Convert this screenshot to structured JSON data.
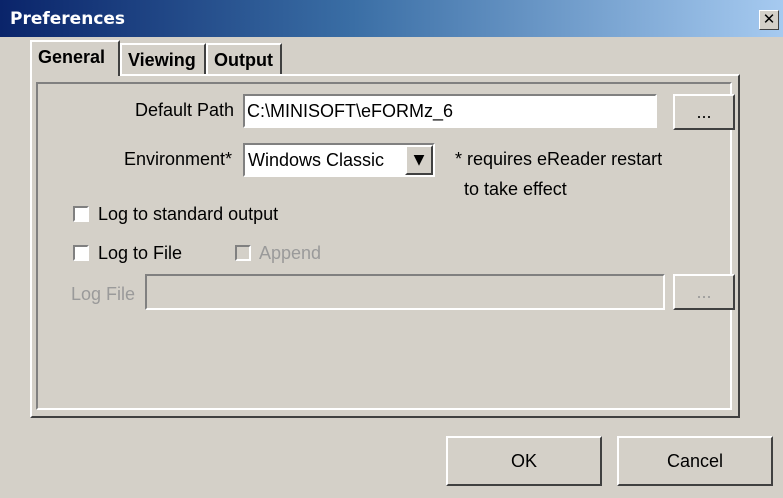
{
  "window": {
    "title": "Preferences",
    "close_glyph": "✕"
  },
  "tabs": [
    {
      "label": "General",
      "active": true
    },
    {
      "label": "Viewing",
      "active": false
    },
    {
      "label": "Output",
      "active": false
    }
  ],
  "general": {
    "default_path_label": "Default Path",
    "default_path_value": "C:\\MINISOFT\\eFORMz_6",
    "browse_label": "...",
    "environment_label": "Environment*",
    "environment_value": "Windows Classic",
    "environment_note_line1": "* requires eReader restart",
    "environment_note_line2": "to take effect",
    "log_stdout_label": "Log to standard output",
    "log_stdout_checked": false,
    "log_file_label": "Log to File",
    "log_file_checked": false,
    "append_label": "Append",
    "append_checked": false,
    "append_enabled": false,
    "log_file_field_label": "Log File",
    "log_file_value": "",
    "log_browse_label": "..."
  },
  "footer": {
    "ok_label": "OK",
    "cancel_label": "Cancel"
  },
  "icons": {
    "dropdown": "chevron-down-icon",
    "close": "close-icon"
  }
}
